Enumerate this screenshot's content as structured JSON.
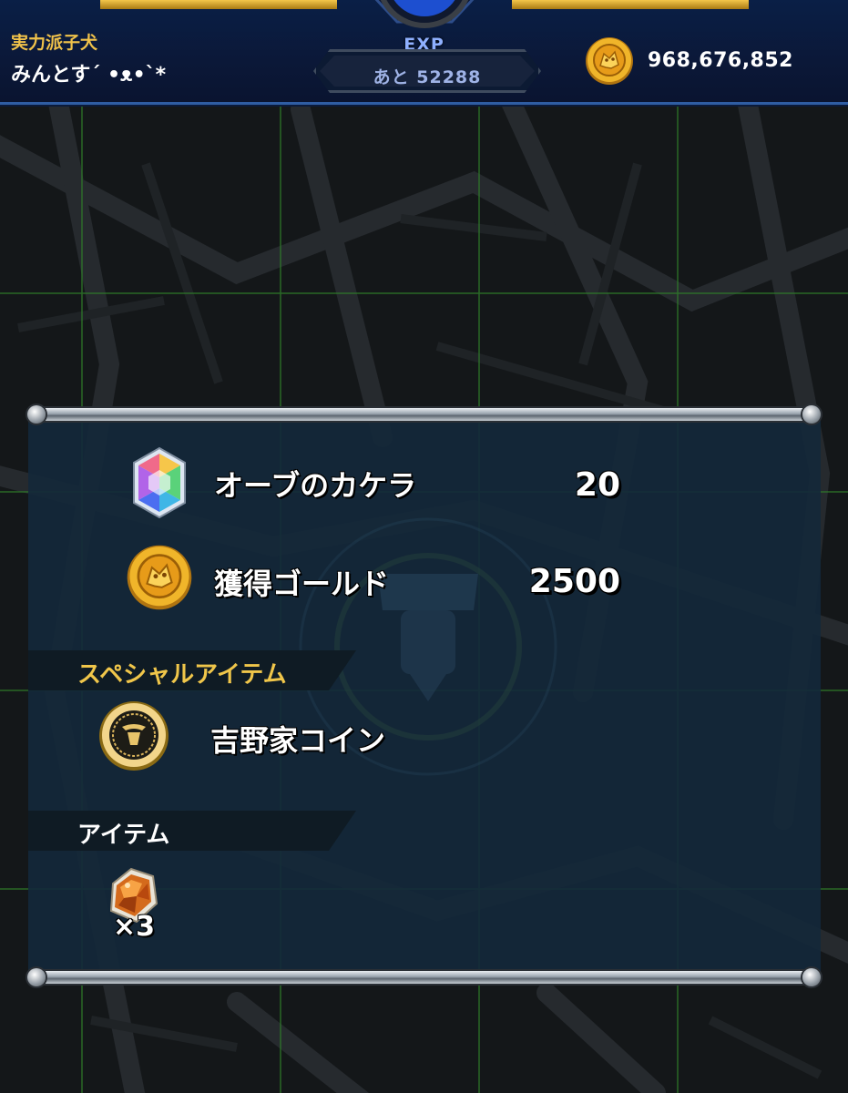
{
  "header": {
    "player_title": "実力派子犬",
    "player_name": "みんとす´ •ᴥ•`*",
    "exp_label": "EXP",
    "exp_remaining": "あと 52288",
    "gold_total": "968,676,852"
  },
  "rewards": {
    "orb_fragment": {
      "label": "オーブのカケラ",
      "value": "20",
      "icon": "rainbow-gem-icon"
    },
    "gold": {
      "label": "獲得ゴールド",
      "value": "2500",
      "icon": "gold-coin-icon"
    }
  },
  "special_items": {
    "title": "スペシャルアイテム",
    "items": [
      {
        "label": "吉野家コイン",
        "icon": "yoshinoya-coin-icon"
      }
    ]
  },
  "items": {
    "title": "アイテム",
    "list": [
      {
        "icon": "amber-crystal-icon",
        "count": "×3"
      }
    ]
  },
  "colors": {
    "header_bg": "#0b1838",
    "gold_text": "#f0c24a",
    "panel_bg": "#14283a",
    "map_grid": "#2f7d2a"
  }
}
